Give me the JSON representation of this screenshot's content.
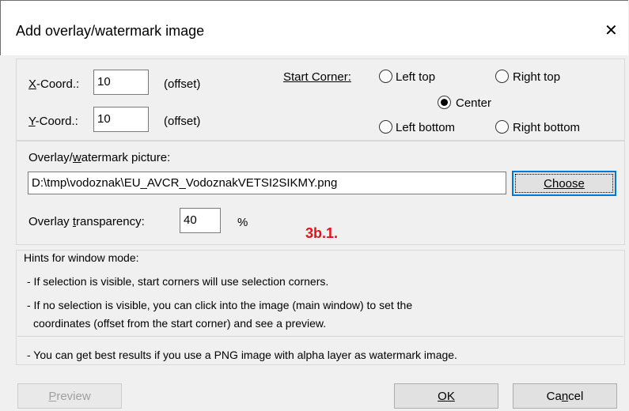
{
  "window": {
    "title": "Add overlay/watermark image"
  },
  "coords": {
    "x_label": "X-Coord.:",
    "x_value": "10",
    "x_suffix": "(offset)",
    "y_label": "Y-Coord.:",
    "y_value": "10",
    "y_suffix": "(offset)"
  },
  "start_corner": {
    "label": "Start Corner:",
    "options": [
      {
        "label": "Left top",
        "checked": false
      },
      {
        "label": "Right top",
        "checked": false
      },
      {
        "label": "Center",
        "checked": true
      },
      {
        "label": "Left bottom",
        "checked": false
      },
      {
        "label": "Right bottom",
        "checked": false
      }
    ]
  },
  "overlay": {
    "picture_label": "Overlay/watermark picture:",
    "picture_path": "D:\\tmp\\vodoznak\\EU_AVCR_VodoznakVETSI2SIKMY.png",
    "choose_label": "Choose",
    "transparency_label": "Overlay transparency:",
    "transparency_value": "40",
    "transparency_unit": "%"
  },
  "annotation": "3b.1.",
  "hints": {
    "title": "Hints for window mode:",
    "line1": "- If selection is visible, start corners will use selection corners.",
    "line2": "- If no selection is visible, you can click into the image (main window) to set the",
    "line3": "coordinates (offset from the start corner) and see a preview.",
    "line4": "- You can get best results if you use a PNG image with alpha layer as watermark image."
  },
  "buttons": {
    "preview": "Preview",
    "ok": "OK",
    "cancel": "Cancel"
  },
  "colors": {
    "accent": "#0078d7",
    "annotation": "#e3111a",
    "dialog_bg": "#f0f0f0"
  }
}
